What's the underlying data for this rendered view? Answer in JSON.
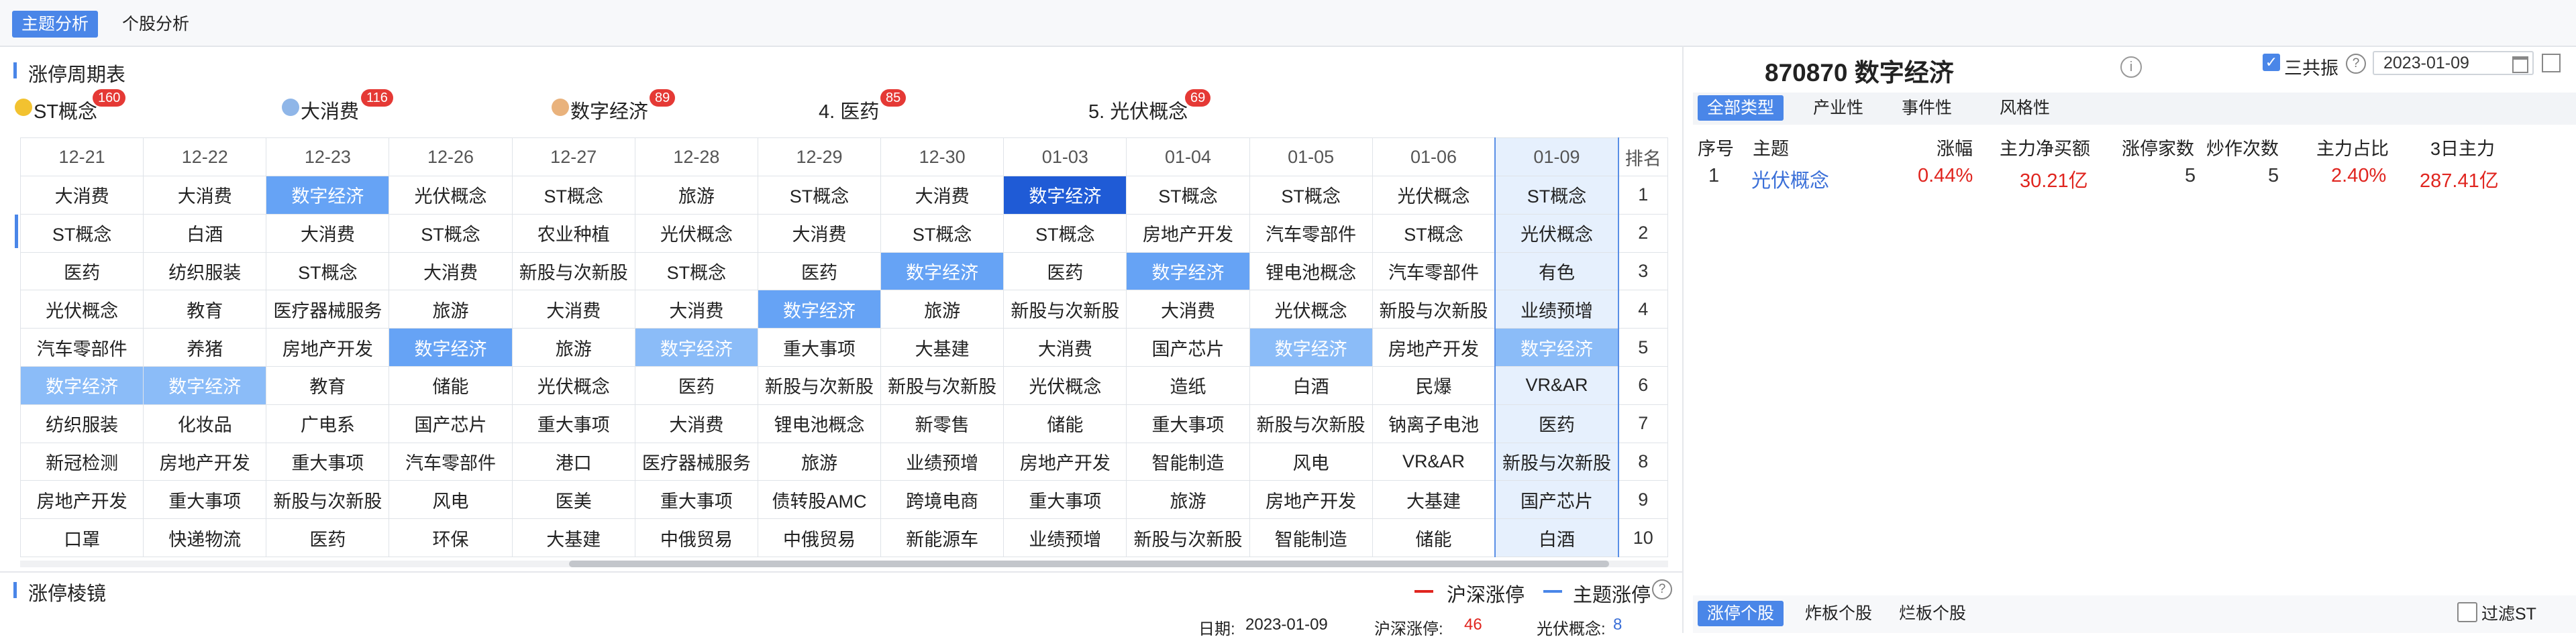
{
  "top_tabs": [
    "主题分析",
    "个股分析"
  ],
  "section_limitup_title": "涨停周期表",
  "section_prism_title": "涨停棱镜",
  "legend": [
    {
      "label": "ST概念",
      "count": "160",
      "icon": "gold-coin-icon",
      "color": "#f2c230"
    },
    {
      "label": "大消费",
      "count": "116",
      "icon": "blue-gem-icon",
      "color": "#8fb6e8"
    },
    {
      "label": "数字经济",
      "count": "89",
      "icon": "orange-orb-icon",
      "color": "#e9b27c"
    },
    {
      "label": "4. 医药",
      "count": "85",
      "icon": "",
      "color": ""
    },
    {
      "label": "5. 光伏概念",
      "count": "69",
      "icon": "",
      "color": ""
    }
  ],
  "grid": {
    "dates": [
      "12-21",
      "12-22",
      "12-23",
      "12-26",
      "12-27",
      "12-28",
      "12-29",
      "12-30",
      "01-03",
      "01-04",
      "01-05",
      "01-06",
      "01-09"
    ],
    "rank_header": "排名",
    "rows": [
      [
        "大消费",
        "大消费",
        "数字经济",
        "光伏概念",
        "ST概念",
        "旅游",
        "ST概念",
        "大消费",
        "数字经济",
        "ST概念",
        "ST概念",
        "光伏概念",
        "ST概念"
      ],
      [
        "ST概念",
        "白酒",
        "大消费",
        "ST概念",
        "农业种植",
        "光伏概念",
        "大消费",
        "ST概念",
        "ST概念",
        "房地产开发",
        "汽车零部件",
        "ST概念",
        "光伏概念"
      ],
      [
        "医药",
        "纺织服装",
        "ST概念",
        "大消费",
        "新股与次新股",
        "ST概念",
        "医药",
        "数字经济",
        "医药",
        "数字经济",
        "锂电池概念",
        "汽车零部件",
        "有色"
      ],
      [
        "光伏概念",
        "教育",
        "医疗器械服务",
        "旅游",
        "大消费",
        "大消费",
        "数字经济",
        "旅游",
        "新股与次新股",
        "大消费",
        "光伏概念",
        "新股与次新股",
        "业绩预增"
      ],
      [
        "汽车零部件",
        "养猪",
        "房地产开发",
        "数字经济",
        "旅游",
        "数字经济",
        "重大事项",
        "大基建",
        "大消费",
        "国产芯片",
        "数字经济",
        "房地产开发",
        "数字经济"
      ],
      [
        "数字经济",
        "数字经济",
        "教育",
        "储能",
        "光伏概念",
        "医药",
        "新股与次新股",
        "新股与次新股",
        "光伏概念",
        "造纸",
        "白酒",
        "民爆",
        "VR&AR"
      ],
      [
        "纺织服装",
        "化妆品",
        "广电系",
        "国产芯片",
        "重大事项",
        "大消费",
        "锂电池概念",
        "新零售",
        "储能",
        "重大事项",
        "新股与次新股",
        "钠离子电池",
        "医药"
      ],
      [
        "新冠检测",
        "房地产开发",
        "重大事项",
        "汽车零部件",
        "港口",
        "医疗器械服务",
        "旅游",
        "业绩预增",
        "房地产开发",
        "智能制造",
        "风电",
        "VR&AR",
        "新股与次新股"
      ],
      [
        "房地产开发",
        "重大事项",
        "新股与次新股",
        "风电",
        "医美",
        "重大事项",
        "债转股AMC",
        "跨境电商",
        "重大事项",
        "旅游",
        "房地产开发",
        "大基建",
        "国产芯片"
      ],
      [
        "口罩",
        "快递物流",
        "医药",
        "环保",
        "大基建",
        "中俄贸易",
        "中俄贸易",
        "新能源车",
        "业绩预增",
        "新股与次新股",
        "智能制造",
        "储能",
        "白酒"
      ]
    ],
    "ranks": [
      "1",
      "2",
      "3",
      "4",
      "5",
      "6",
      "7",
      "8",
      "9",
      "10"
    ]
  },
  "prism": {
    "legend_a": "沪深涨停",
    "legend_b": "主题涨停",
    "legend_a_color": "#e0251f",
    "legend_b_color": "#4a86e8",
    "date_label": "日期:",
    "date_value": "2023-01-09",
    "hs_label": "沪深涨停:",
    "hs_value": "46",
    "theme_label": "光伏概念:",
    "theme_value": "8"
  },
  "right": {
    "title": "870870 数字经济",
    "checkbox_label": "三共振",
    "date": "2023-01-09",
    "tabs": [
      "全部类型",
      "产业性",
      "事件性",
      "风格性"
    ],
    "headers": [
      "序号",
      "主题",
      "涨幅",
      "主力净买额",
      "涨停家数",
      "炒作次数",
      "主力占比",
      "3日主力"
    ],
    "row": [
      "1",
      "光伏概念",
      "0.44%",
      "30.21亿",
      "5",
      "5",
      "2.40%",
      "287.41亿"
    ],
    "bottom_tabs": [
      "涨停个股",
      "炸板个股",
      "烂板个股"
    ],
    "filter_label": "过滤ST"
  }
}
